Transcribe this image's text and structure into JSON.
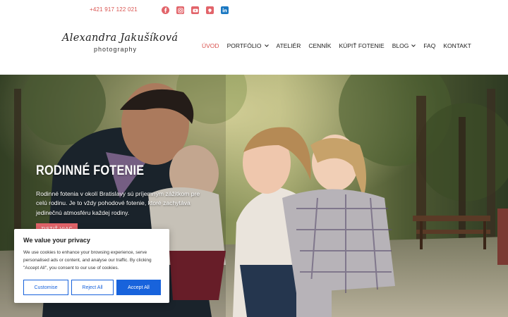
{
  "topbar": {
    "phone": "+421 917 122 021",
    "social": [
      {
        "name": "facebook-icon",
        "color": "#e2646a"
      },
      {
        "name": "instagram-icon",
        "color": "#e2646a"
      },
      {
        "name": "youtube-icon",
        "color": "#e2646a"
      },
      {
        "name": "pinterest-icon",
        "color": "#e2646a"
      },
      {
        "name": "linkedin-icon",
        "color": "#1a78c2"
      }
    ]
  },
  "logo": {
    "name": "Alexandra Jakušíková",
    "subtitle": "photography"
  },
  "nav": {
    "items": [
      {
        "label": "ÚVOD",
        "active": true,
        "dropdown": false
      },
      {
        "label": "PORTFÓLIO",
        "active": false,
        "dropdown": true
      },
      {
        "label": "ATELIÉR",
        "active": false,
        "dropdown": false
      },
      {
        "label": "CENNÍK",
        "active": false,
        "dropdown": false
      },
      {
        "label": "KÚPIŤ FOTENIE",
        "active": false,
        "dropdown": false
      },
      {
        "label": "BLOG",
        "active": false,
        "dropdown": true
      },
      {
        "label": "FAQ",
        "active": false,
        "dropdown": false
      },
      {
        "label": "KONTAKT",
        "active": false,
        "dropdown": false
      }
    ]
  },
  "hero": {
    "title": "RODINNÉ FOTENIE",
    "text": "Rodinné fotenia v okolí Bratislavy sú príjemným zážitkom pre celú rodinu. Je to vždy pohodové fotenie, ktoré zachytáva jedinečnú atmosféru každej rodiny.",
    "button": "ZISTIŤ VIAC"
  },
  "cookie": {
    "title": "We value your privacy",
    "text": "We use cookies to enhance your browsing experience, serve personalised ads or content, and analyse our traffic. By clicking \"Accept All\", you consent to our use of cookies.",
    "customise": "Customise",
    "reject": "Reject All",
    "accept": "Accept All"
  },
  "colors": {
    "accent": "#e2646a",
    "cookie_primary": "#1863dc"
  }
}
